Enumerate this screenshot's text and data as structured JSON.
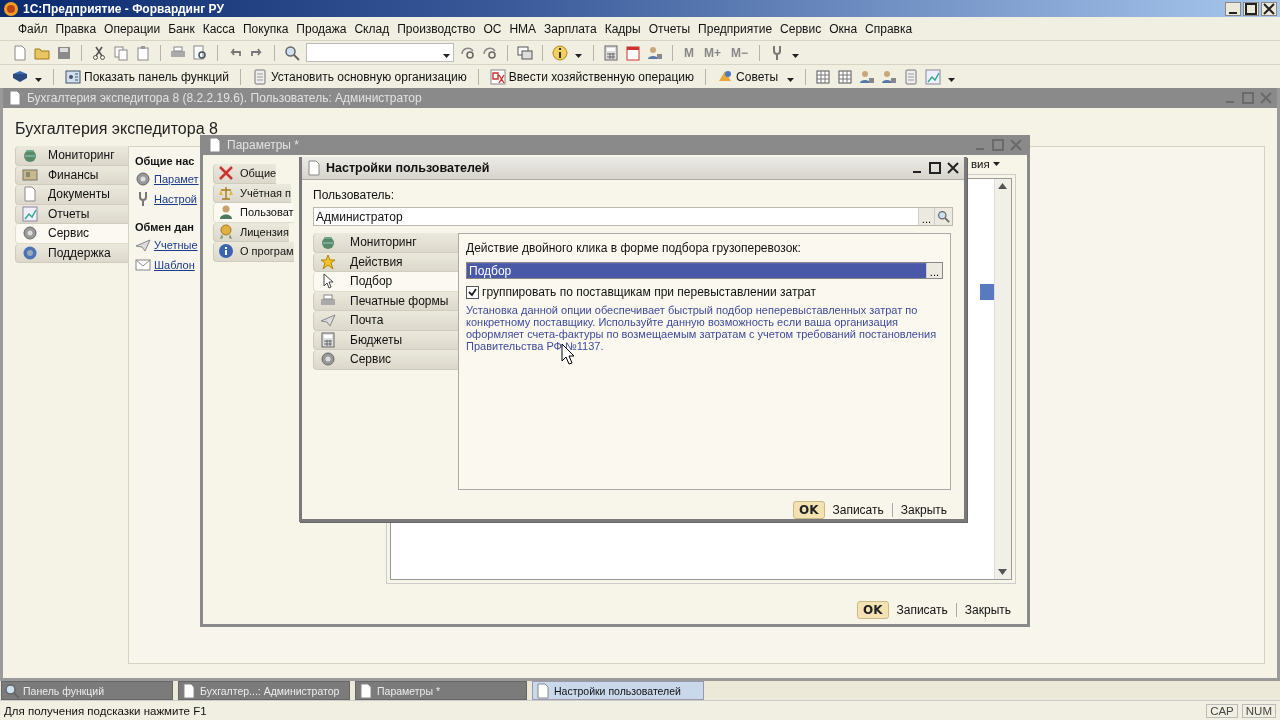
{
  "app_title": "1С:Предприятие - Форвардинг РУ",
  "menu": [
    "Файл",
    "Правка",
    "Операции",
    "Банк",
    "Касса",
    "Покупка",
    "Продажа",
    "Склад",
    "Производство",
    "ОС",
    "НМА",
    "Зарплата",
    "Кадры",
    "Отчеты",
    "Предприятие",
    "Сервис",
    "Окна",
    "Справка"
  ],
  "toolbar": {
    "memory_buttons": [
      "M",
      "M+",
      "M−"
    ]
  },
  "function_bar": [
    "Показать панель функций",
    "Установить основную организацию",
    "Ввести хозяйственную операцию",
    "Советы"
  ],
  "document_window": {
    "title": "Бухгалтерия экспедитора 8 (8.2.2.19.6). Пользователь: Администратор",
    "heading": "Бухгалтерия экспедитора 8",
    "nav": [
      {
        "label": "Мониторинг",
        "selected": false
      },
      {
        "label": "Финансы",
        "selected": false
      },
      {
        "label": "Документы",
        "selected": false
      },
      {
        "label": "Отчеты",
        "selected": false
      },
      {
        "label": "Сервис",
        "selected": true
      },
      {
        "label": "Поддержка",
        "selected": false
      }
    ],
    "sections": [
      {
        "title": "Общие нас",
        "links": [
          "Парамет",
          "Настрой"
        ]
      },
      {
        "title": "Обмен дан",
        "links": [
          "Учетные",
          "Шаблон"
        ]
      }
    ]
  },
  "parameters_window": {
    "title": "Параметры *",
    "nav": [
      {
        "label": "Общие",
        "selected": false
      },
      {
        "label": "Учётная п",
        "selected": false
      },
      {
        "label": "Пользоват",
        "selected": true
      },
      {
        "label": "Лицензия",
        "selected": false
      },
      {
        "label": "О програм",
        "selected": false
      }
    ],
    "menu_label": "вия",
    "buttons": [
      "OK",
      "Записать",
      "Закрыть"
    ]
  },
  "user_settings_window": {
    "title": "Настройки пользователей",
    "user_label": "Пользователь:",
    "user_value": "Администратор",
    "picker": "...",
    "nav": [
      {
        "label": "Мониторинг",
        "selected": false
      },
      {
        "label": "Действия",
        "selected": false
      },
      {
        "label": "Подбор",
        "selected": true
      },
      {
        "label": "Печатные формы",
        "selected": false
      },
      {
        "label": "Почта",
        "selected": false
      },
      {
        "label": "Бюджеты",
        "selected": false
      },
      {
        "label": "Сервис",
        "selected": false
      }
    ],
    "option_label": "Действие двойного клика в форме подбора грузоперевозок:",
    "option_value": "Подбор",
    "option_picker": "...",
    "group_checkbox": {
      "label": "группировать по поставщикам при перевыставлении затрат",
      "checked": true
    },
    "hint": "Установка данной опции обеспечивает быстрый подбор неперевыставленных затрат по конкретному поставщику. Используйте данную возможность если ваша организация оформляет счета-фактуры по возмещаемым затратам с учетом требований постановления Правительства РФ №1137.",
    "buttons": [
      "OK",
      "Записать",
      "Закрыть"
    ]
  },
  "taskbar": [
    {
      "label": "Панель функций",
      "selected": false
    },
    {
      "label": "Бухгалтер...: Администратор",
      "selected": false
    },
    {
      "label": "Параметры *",
      "selected": false
    },
    {
      "label": "Настройки пользователей",
      "selected": true
    }
  ],
  "status_bar": {
    "hint": "Для получения подсказки нажмите F1",
    "indicators": [
      "CAP",
      "NUM"
    ]
  }
}
